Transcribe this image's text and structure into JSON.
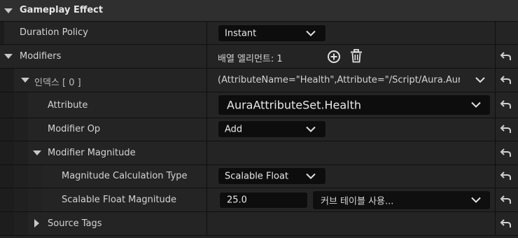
{
  "section": {
    "title": "Gameplay Effect"
  },
  "duration_policy": {
    "label": "Duration Policy",
    "value": "Instant"
  },
  "modifiers": {
    "label": "Modifiers",
    "element_count": "배열 엘리먼트: 1",
    "add_icon": "plus-circle-icon",
    "delete_icon": "trash-icon"
  },
  "index0": {
    "label": "인덱스 [ 0 ]",
    "summary": "(AttributeName=\"Health\",Attribute=\"/Script/Aura.AuraAttribu"
  },
  "attribute": {
    "label": "Attribute",
    "value": "AuraAttributeSet.Health"
  },
  "modifier_op": {
    "label": "Modifier Op",
    "value": "Add"
  },
  "modifier_magnitude": {
    "label": "Modifier Magnitude"
  },
  "calc_type": {
    "label": "Magnitude Calculation Type",
    "value": "Scalable Float"
  },
  "scalable_float": {
    "label": "Scalable Float Magnitude",
    "value": "25.0",
    "curve_table_placeholder": "커브 테이블 사용..."
  },
  "source_tags": {
    "label": "Source Tags"
  },
  "colors": {
    "background": "#151515",
    "row": "#242424",
    "header": "#2f2f2f",
    "field": "#0d0d0d",
    "text": "#d6d6d6"
  },
  "icons": {
    "expand": "triangle-down-icon",
    "collapsed": "triangle-right-icon",
    "reset": "reset-arrow-icon",
    "dropdown": "chevron-down-icon"
  }
}
